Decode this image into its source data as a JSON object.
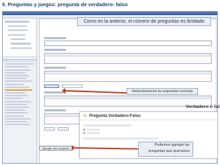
{
  "slide": {
    "title": "5. Preguntas y juegos: pregunta de verdadero- falso"
  },
  "callouts": {
    "top": "Como en la anterior, el número de preguntas es ilimitado",
    "middle": "Seleccionamos la respuesta correcta",
    "bottom": "Podemos agregar las preguntas que queramos"
  },
  "preview": {
    "title": "Pregunta Verdadero-Falso",
    "window_label": "Verdadero o falso"
  },
  "editor": {
    "add_button_label": "Agregar otra pregunta"
  },
  "colors": {
    "accent": "#c23b22",
    "title": "#1f3f73",
    "callout_bg": "#e9eef6"
  }
}
